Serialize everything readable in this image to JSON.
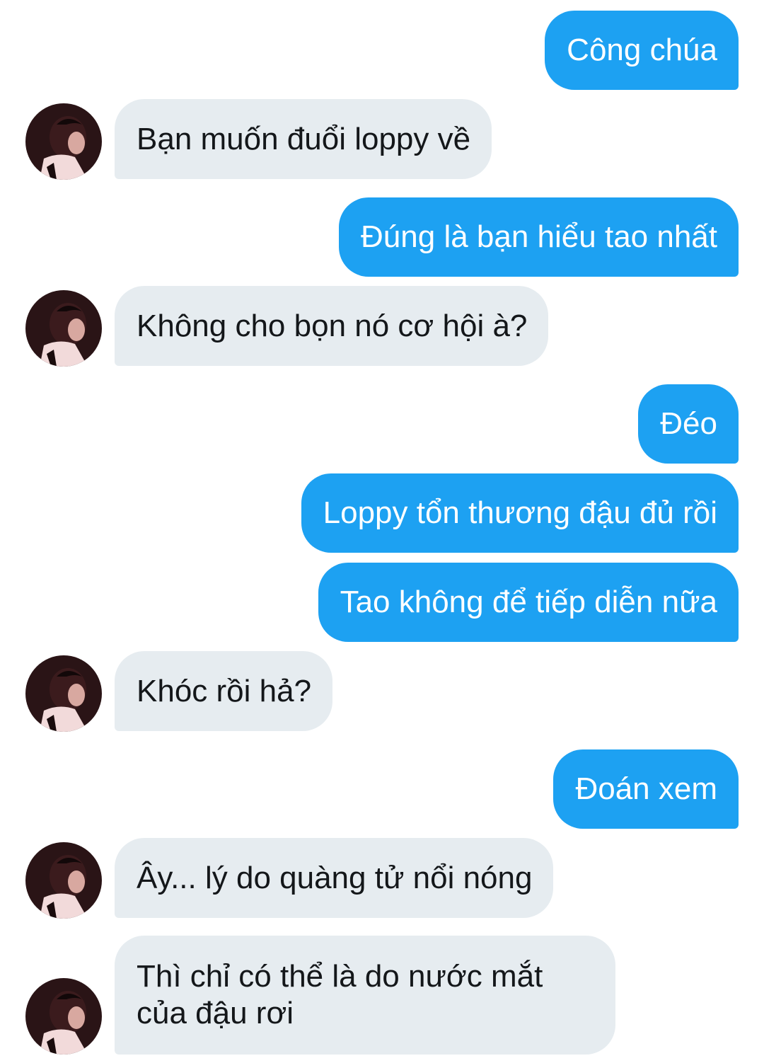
{
  "conversation": {
    "messages": [
      {
        "side": "out",
        "text": "Công chúa"
      },
      {
        "side": "in",
        "text": "Bạn muốn đuổi loppy về"
      },
      {
        "side": "out",
        "text": "Đúng là bạn hiểu tao nhất"
      },
      {
        "side": "in",
        "text": "Không cho bọn nó cơ hội à?"
      },
      {
        "side": "out",
        "text": "Đéo"
      },
      {
        "side": "out",
        "text": "Loppy tổn thương đậu đủ rồi"
      },
      {
        "side": "out",
        "text": "Tao không để tiếp diễn nữa"
      },
      {
        "side": "in",
        "text": "Khóc rồi hả?"
      },
      {
        "side": "out",
        "text": "Đoán xem"
      },
      {
        "side": "in",
        "text": "Ây... lý do quàng tử nổi nóng"
      },
      {
        "side": "in",
        "text": "Thì chỉ có thể là do nước mắt của đậu rơi"
      }
    ]
  },
  "colors": {
    "outgoing_bubble": "#1da1f2",
    "incoming_bubble": "#e6ecf0",
    "outgoing_text": "#ffffff",
    "incoming_text": "#14171a"
  },
  "icons": {
    "avatar": "contact-avatar-icon"
  }
}
